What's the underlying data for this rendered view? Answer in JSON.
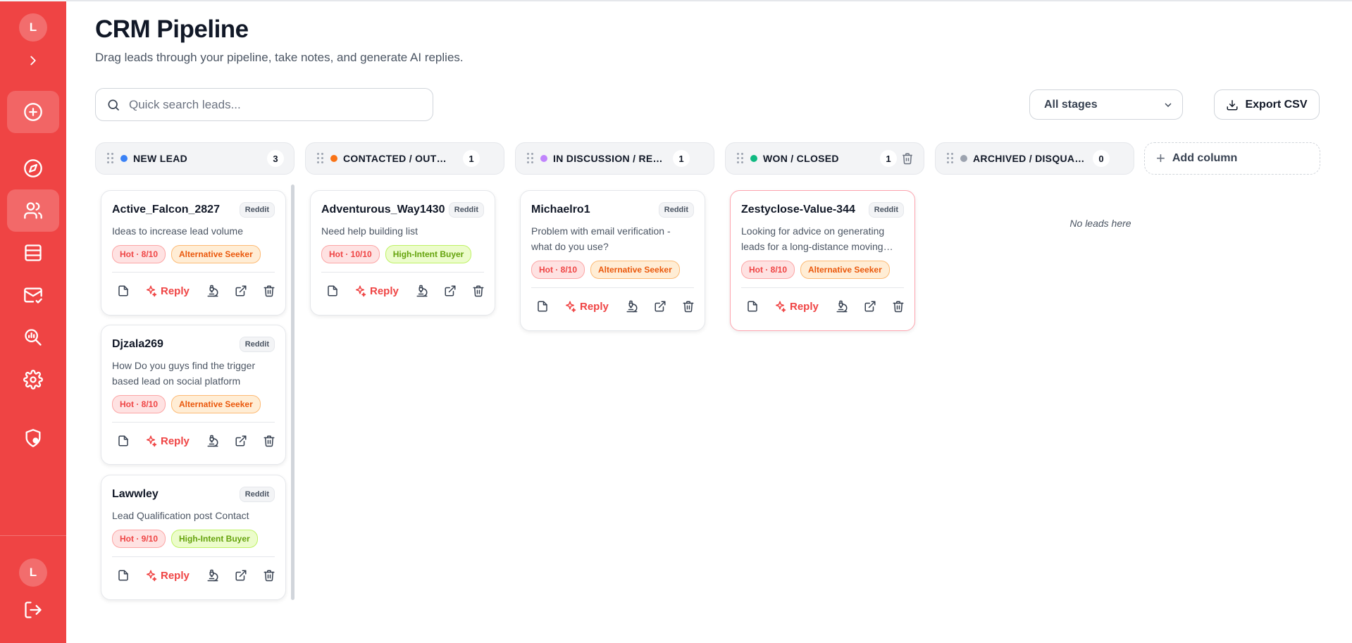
{
  "sidebar": {
    "avatar_top": "L",
    "avatar_bottom": "L",
    "items": [
      {
        "name": "expand-icon"
      },
      {
        "name": "add-circle-icon"
      },
      {
        "name": "compass-icon"
      },
      {
        "name": "users-icon",
        "active": true
      },
      {
        "name": "table-icon"
      },
      {
        "name": "mail-check-icon"
      },
      {
        "name": "search-analytics-icon"
      },
      {
        "name": "gear-icon"
      },
      {
        "name": "shield-user-icon"
      },
      {
        "name": "logout-icon"
      }
    ]
  },
  "header": {
    "title": "CRM Pipeline",
    "subtitle": "Drag leads through your pipeline, take notes, and generate AI replies."
  },
  "toolbar": {
    "search_placeholder": "Quick search leads...",
    "stage_filter": "All stages",
    "export_label": "Export CSV",
    "add_column_label": "Add column"
  },
  "columns": [
    {
      "title": "NEW LEAD",
      "count": "3",
      "color": "#3b82f6"
    },
    {
      "title": "CONTACTED / OUTREACH",
      "count": "1",
      "color": "#f97316"
    },
    {
      "title": "IN DISCUSSION / REPLIED",
      "count": "1",
      "color": "#c084fc"
    },
    {
      "title": "WON / CLOSED",
      "count": "1",
      "color": "#10b981"
    },
    {
      "title": "ARCHIVED / DISQUALIFIED",
      "count": "0",
      "color": "#9ca3af"
    }
  ],
  "empty_text": "No leads here",
  "reply_label": "Reply",
  "cards": [
    {
      "name": "Active_Falcon_2827",
      "source": "Reddit",
      "desc": "Ideas to increase lead volume",
      "score": "Hot · 8/10",
      "intent": "Alternative Seeker"
    },
    {
      "name": "Djzala269",
      "source": "Reddit",
      "desc": "How Do you guys find the trigger based lead on social platform",
      "score": "Hot · 8/10",
      "intent": "Alternative Seeker"
    },
    {
      "name": "Lawwley",
      "source": "Reddit",
      "desc": "Lead Qualification post Contact",
      "score": "Hot · 9/10",
      "intent": "High-Intent Buyer"
    },
    {
      "name": "Adventurous_Way1430",
      "source": "Reddit",
      "desc": "Need help building list",
      "score": "Hot · 10/10",
      "intent": "High-Intent Buyer"
    },
    {
      "name": "Michaelro1",
      "source": "Reddit",
      "desc": "Problem with email verification - what do you use?",
      "score": "Hot · 8/10",
      "intent": "Alternative Seeker"
    },
    {
      "name": "Zestyclose-Value-344",
      "source": "Reddit",
      "desc": "Looking for advice on generating leads for a long-distance moving company",
      "score": "Hot · 8/10",
      "intent": "Alternative Seeker"
    }
  ]
}
